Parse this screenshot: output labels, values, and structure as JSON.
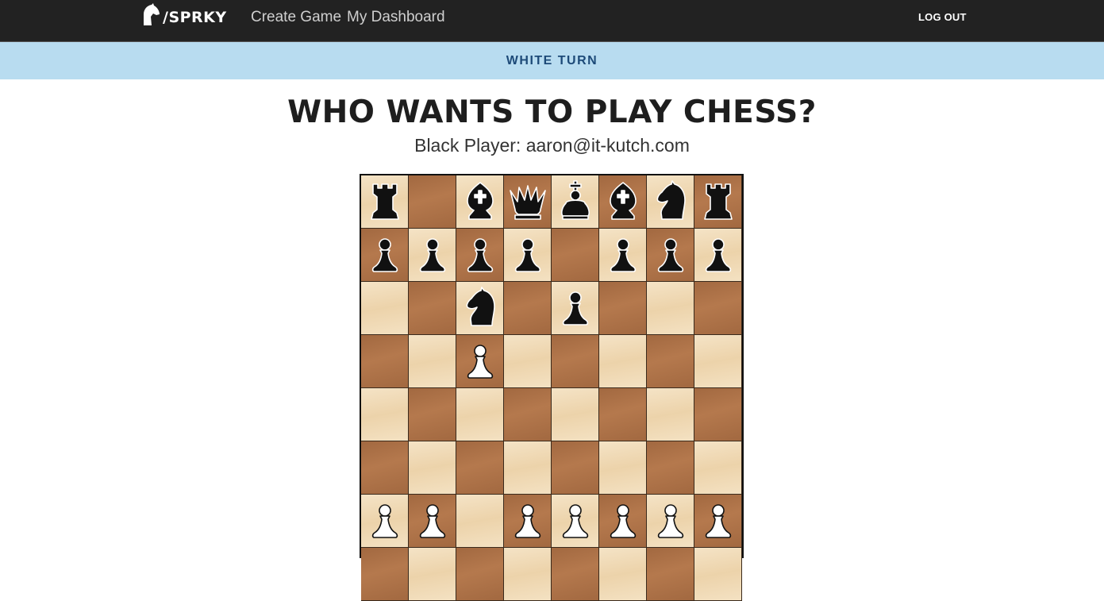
{
  "header": {
    "logo_text": "/SPRKY",
    "nav": [
      {
        "label": "Create Game"
      },
      {
        "label": "My Dashboard"
      }
    ],
    "logout_label": "LOG OUT"
  },
  "turn_banner": "WHITE TURN",
  "page_title": "WHO WANTS TO PLAY CHESS?",
  "subtitle": "Black Player: aaron@it-kutch.com",
  "board": {
    "light_color": "#f1dab3",
    "dark_color": "#b0744a",
    "ranks": [
      [
        "bR",
        "",
        "bB",
        "bQ",
        "bK",
        "bB",
        "bN",
        "bR"
      ],
      [
        "bP",
        "bP",
        "bP",
        "bP",
        "",
        "bP",
        "bP",
        "bP"
      ],
      [
        "",
        "",
        "bN",
        "",
        "bP",
        "",
        "",
        ""
      ],
      [
        "",
        "",
        "wP",
        "",
        "",
        "",
        "",
        ""
      ],
      [
        "",
        "",
        "",
        "",
        "",
        "",
        "",
        ""
      ],
      [
        "",
        "",
        "",
        "",
        "",
        "",
        "",
        ""
      ],
      [
        "wP",
        "wP",
        "",
        "wP",
        "wP",
        "wP",
        "wP",
        "wP"
      ],
      [
        "",
        "",
        "",
        "",
        "",
        "",
        "",
        ""
      ]
    ]
  }
}
